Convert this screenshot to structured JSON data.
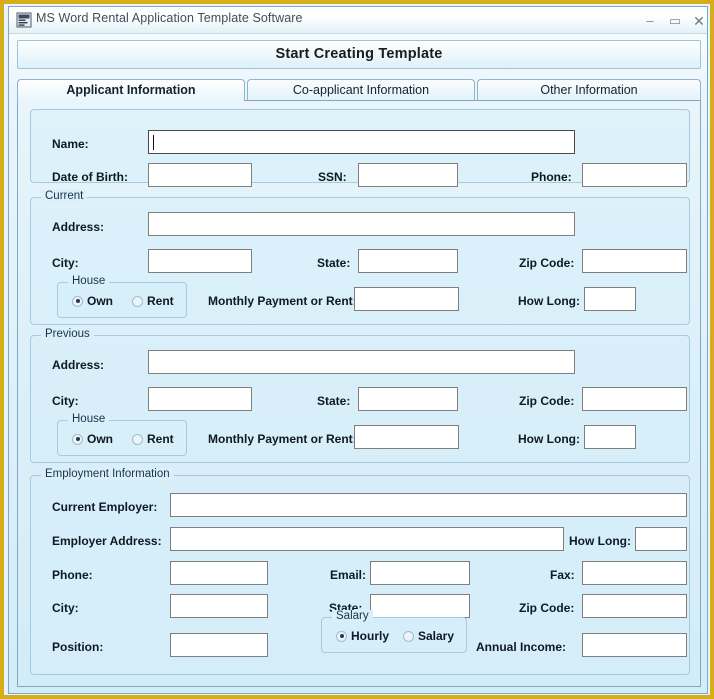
{
  "window": {
    "title": "MS Word Rental Application Template Software",
    "icon": "app-icon",
    "minimize": "–",
    "maximize": "▭",
    "close": "✕"
  },
  "toolbar": {
    "start_label": "Start Creating Template"
  },
  "tabs": [
    {
      "label": "Applicant Information",
      "active": true
    },
    {
      "label": "Co-applicant Information",
      "active": false
    },
    {
      "label": "Other Information",
      "active": false
    }
  ],
  "applicant": {
    "personal": {
      "name_label": "Name:",
      "name_value": "",
      "dob_label": "Date of Birth:",
      "dob_value": "",
      "ssn_label": "SSN:",
      "ssn_value": "",
      "phone_label": "Phone:",
      "phone_value": ""
    },
    "current": {
      "group_title": "Current",
      "address_label": "Address:",
      "address_value": "",
      "city_label": "City:",
      "city_value": "",
      "state_label": "State:",
      "state_value": "",
      "zip_label": "Zip Code:",
      "zip_value": "",
      "house_group_title": "House",
      "own_label": "Own",
      "rent_label": "Rent",
      "house_selected": "Own",
      "payment_label": "Monthly Payment or Rent:",
      "payment_value": "",
      "how_long_label": "How Long:",
      "how_long_value": ""
    },
    "previous": {
      "group_title": "Previous",
      "address_label": "Address:",
      "address_value": "",
      "city_label": "City:",
      "city_value": "",
      "state_label": "State:",
      "state_value": "",
      "zip_label": "Zip Code:",
      "zip_value": "",
      "house_group_title": "House",
      "own_label": "Own",
      "rent_label": "Rent",
      "house_selected": "Own",
      "payment_label": "Monthly Payment or Rent:",
      "payment_value": "",
      "how_long_label": "How Long:",
      "how_long_value": ""
    },
    "employment": {
      "group_title": "Employment Information",
      "employer_label": "Current Employer:",
      "employer_value": "",
      "employer_address_label": "Employer Address:",
      "employer_address_value": "",
      "how_long_label": "How Long:",
      "how_long_value": "",
      "phone_label": "Phone:",
      "phone_value": "",
      "email_label": "Email:",
      "email_value": "",
      "fax_label": "Fax:",
      "fax_value": "",
      "city_label": "City:",
      "city_value": "",
      "state_label": "State:",
      "state_value": "",
      "zip_label": "Zip Code:",
      "zip_value": "",
      "position_label": "Position:",
      "position_value": "",
      "salary_group_title": "Salary",
      "hourly_label": "Hourly",
      "salary_label": "Salary",
      "salary_selected": "Hourly",
      "annual_income_label": "Annual Income:",
      "annual_income_value": ""
    }
  },
  "colors": {
    "frame": "#d5ae19",
    "panel_bg": "#d9eff9",
    "accent_border": "#7fa8c4"
  }
}
